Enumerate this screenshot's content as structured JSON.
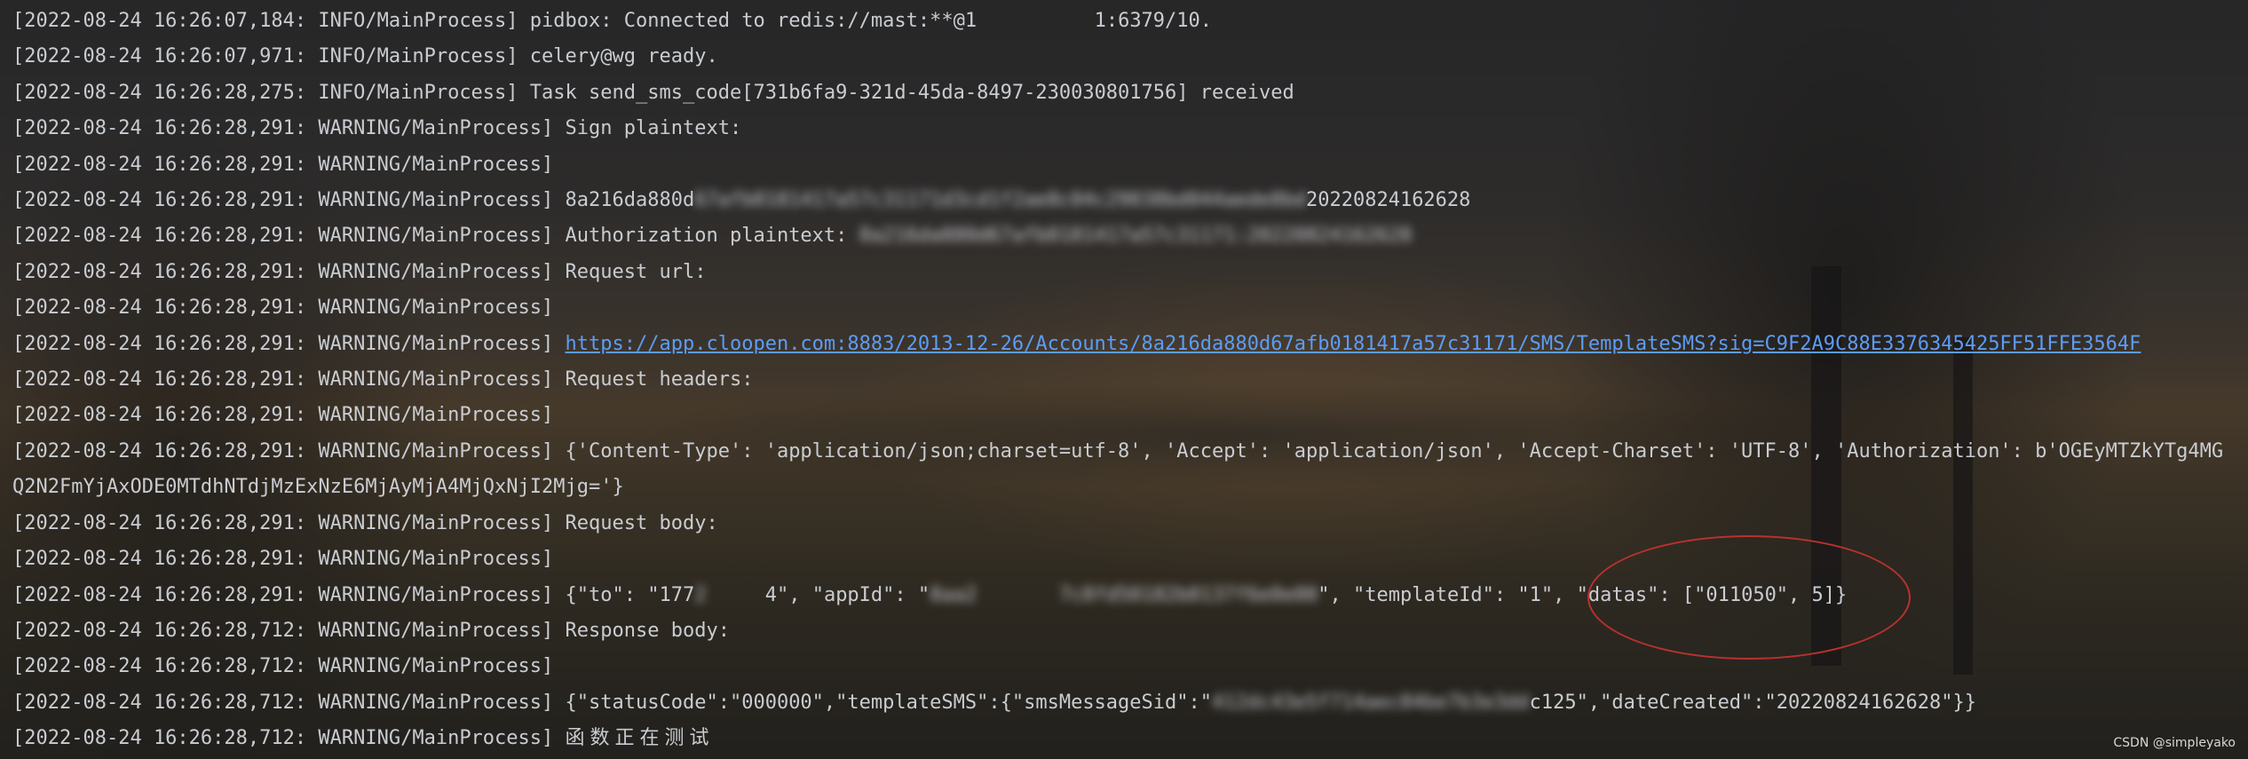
{
  "log_lines": [
    {
      "prefix": "[2022-08-24 16:26:07,184: INFO/MainProcess] ",
      "parts": [
        {
          "text": "pidbox: Connected to redis://mast:**@1",
          "style": "plain"
        },
        {
          "text": "          ",
          "style": "blur"
        },
        {
          "text": "1:6379/10.",
          "style": "plain"
        }
      ]
    },
    {
      "prefix": "[2022-08-24 16:26:07,971: INFO/MainProcess] ",
      "parts": [
        {
          "text": "celery@wg ready.",
          "style": "plain"
        }
      ]
    },
    {
      "prefix": "[2022-08-24 16:26:28,275: INFO/MainProcess] ",
      "parts": [
        {
          "text": "Task send_sms_code[731b6fa9-321d-45da-8497-230030801756] received",
          "style": "plain"
        }
      ]
    },
    {
      "prefix": "[2022-08-24 16:26:28,291: WARNING/MainProcess] ",
      "parts": [
        {
          "text": "Sign plaintext:",
          "style": "plain"
        }
      ]
    },
    {
      "prefix": "[2022-08-24 16:26:28,291: WARNING/MainProcess]",
      "parts": []
    },
    {
      "prefix": "[2022-08-24 16:26:28,291: WARNING/MainProcess] ",
      "parts": [
        {
          "text": "8a216da880d",
          "style": "plain"
        },
        {
          "text": "67afb0181417a57c31171d3cd1f2ae8c04c29038bd044aede8bd",
          "style": "blur"
        },
        {
          "text": "20220824162628",
          "style": "plain"
        }
      ]
    },
    {
      "prefix": "[2022-08-24 16:26:28,291: WARNING/MainProcess] ",
      "parts": [
        {
          "text": "Authorization plaintext: ",
          "style": "plain"
        },
        {
          "text": "8a216da880d67afb0181417a57c31171:20220824162628",
          "style": "blur"
        }
      ]
    },
    {
      "prefix": "[2022-08-24 16:26:28,291: WARNING/MainProcess] ",
      "parts": [
        {
          "text": "Request url:",
          "style": "plain"
        }
      ]
    },
    {
      "prefix": "[2022-08-24 16:26:28,291: WARNING/MainProcess]",
      "parts": []
    },
    {
      "prefix": "[2022-08-24 16:26:28,291: WARNING/MainProcess] ",
      "parts": [
        {
          "text": "https://app.cloopen.com:8883/2013-12-26/Accounts/8a216da880d67afb0181417a57c31171/SMS/TemplateSMS?sig=C9F2A9C88E3376345425FF51FFE3564F",
          "style": "link"
        }
      ]
    },
    {
      "prefix": "[2022-08-24 16:26:28,291: WARNING/MainProcess] ",
      "parts": [
        {
          "text": "Request headers:",
          "style": "plain"
        }
      ]
    },
    {
      "prefix": "[2022-08-24 16:26:28,291: WARNING/MainProcess]",
      "parts": []
    },
    {
      "prefix": "[2022-08-24 16:26:28,291: WARNING/MainProcess] ",
      "wrap": true,
      "parts": [
        {
          "text": "{'Content-Type': 'application/json;charset=utf-8', 'Accept': 'application/json', 'Accept-Charset': 'UTF-8', 'Authorization': b'OGEyMTZkYTg4MGQ2N2FmYjAxODE0MTdhNTdjMzExNzE6MjAyMjA4MjQxNjI2Mjg='}",
          "style": "plain"
        }
      ]
    },
    {
      "prefix": "[2022-08-24 16:26:28,291: WARNING/MainProcess] ",
      "parts": [
        {
          "text": "Request body:",
          "style": "plain"
        }
      ]
    },
    {
      "prefix": "[2022-08-24 16:26:28,291: WARNING/MainProcess]",
      "parts": []
    },
    {
      "prefix": "[2022-08-24 16:26:28,291: WARNING/MainProcess] ",
      "parts": [
        {
          "text": "{\"to\": \"177",
          "style": "plain"
        },
        {
          "text": "2     ",
          "style": "blur"
        },
        {
          "text": "4\", \"appId\": \"",
          "style": "plain"
        },
        {
          "text": "8aa2       7c8fd50182b0137f6e0e00",
          "style": "blur"
        },
        {
          "text": "\", \"templateId\": \"1\", \"datas\": [\"011050\", 5]}",
          "style": "plain"
        }
      ]
    },
    {
      "prefix": "[2022-08-24 16:26:28,712: WARNING/MainProcess] ",
      "parts": [
        {
          "text": "Response body:",
          "style": "plain"
        }
      ]
    },
    {
      "prefix": "[2022-08-24 16:26:28,712: WARNING/MainProcess]",
      "parts": []
    },
    {
      "prefix": "[2022-08-24 16:26:28,712: WARNING/MainProcess] ",
      "parts": [
        {
          "text": "{\"statusCode\":\"000000\",\"templateSMS\":{\"smsMessageSid\":\"",
          "style": "plain"
        },
        {
          "text": "412dc43e5f714aec84be7b3e3dd",
          "style": "blur"
        },
        {
          "text": "c125\",\"dateCreated\":\"20220824162628\"}}",
          "style": "plain"
        }
      ]
    },
    {
      "prefix": "[2022-08-24 16:26:28,712: WARNING/MainProcess] ",
      "parts": [
        {
          "text": "函数正在测试",
          "style": "cn"
        }
      ]
    }
  ],
  "watermark": "CSDN @simpleyako",
  "colors": {
    "text": "#c9ccd1",
    "link": "#5c9cf5",
    "annotation_circle": "#b8322e"
  }
}
